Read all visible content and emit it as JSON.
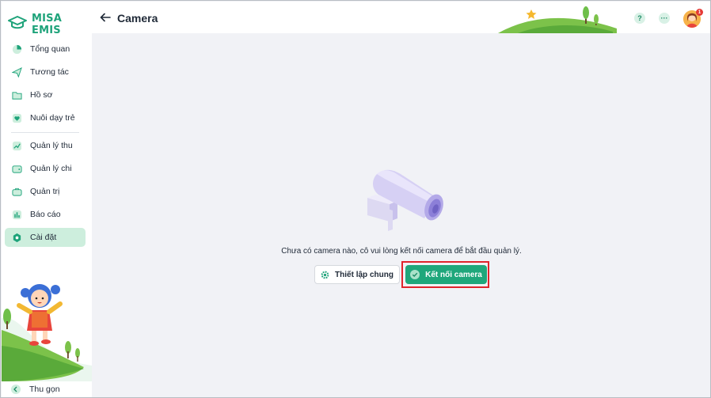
{
  "app": {
    "name": "MISA EMIS"
  },
  "sidebar": {
    "items": [
      {
        "label": "Tổng quan",
        "icon": "pie-chart-icon",
        "active": false
      },
      {
        "label": "Tương tác",
        "icon": "paper-plane-icon",
        "active": false
      },
      {
        "label": "Hồ sơ",
        "icon": "folder-icon",
        "active": false
      },
      {
        "label": "Nuôi dạy trẻ",
        "icon": "heart-icon",
        "active": false
      },
      {
        "label": "Quản lý thu",
        "icon": "income-chart-icon",
        "active": false
      },
      {
        "label": "Quản lý chi",
        "icon": "wallet-icon",
        "active": false
      },
      {
        "label": "Quản trị",
        "icon": "briefcase-icon",
        "active": false
      },
      {
        "label": "Báo cáo",
        "icon": "bar-chart-icon",
        "active": false
      },
      {
        "label": "Cài đặt",
        "icon": "settings-icon",
        "active": true
      }
    ],
    "collapse_label": "Thu gọn"
  },
  "header": {
    "title": "Camera",
    "help_label": "?",
    "more_label": "···",
    "notification_count": "1"
  },
  "main": {
    "empty_message": "Chưa có camera nào, cô vui lòng kết nối camera để bắt đầu quản lý.",
    "settings_button": "Thiết lập chung",
    "connect_button": "Kết nối camera"
  },
  "colors": {
    "brand": "#1ea37a",
    "primary_button": "#1fa77b",
    "active_nav": "#cdeedd",
    "highlight_border": "#e0242c",
    "background": "#f1f2f6"
  }
}
